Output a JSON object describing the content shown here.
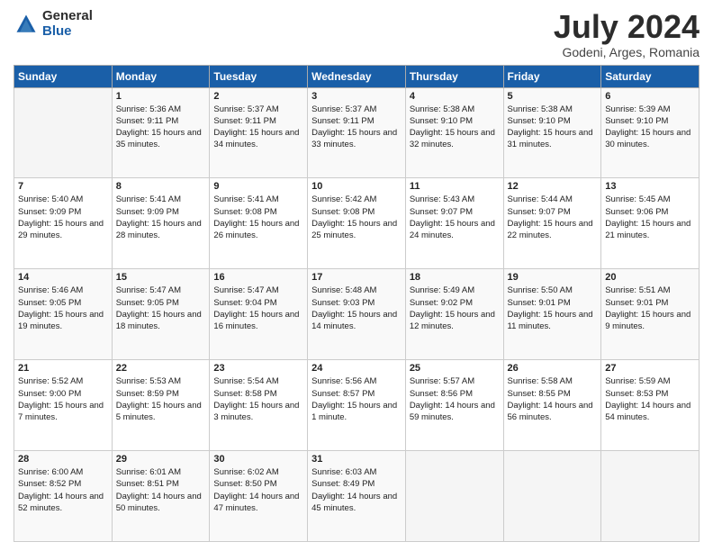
{
  "logo": {
    "general": "General",
    "blue": "Blue"
  },
  "title": {
    "month_year": "July 2024",
    "location": "Godeni, Arges, Romania"
  },
  "days_of_week": [
    "Sunday",
    "Monday",
    "Tuesday",
    "Wednesday",
    "Thursday",
    "Friday",
    "Saturday"
  ],
  "weeks": [
    [
      {
        "day": "",
        "info": ""
      },
      {
        "day": "1",
        "info": "Sunrise: 5:36 AM\nSunset: 9:11 PM\nDaylight: 15 hours and 35 minutes."
      },
      {
        "day": "2",
        "info": "Sunrise: 5:37 AM\nSunset: 9:11 PM\nDaylight: 15 hours and 34 minutes."
      },
      {
        "day": "3",
        "info": "Sunrise: 5:37 AM\nSunset: 9:11 PM\nDaylight: 15 hours and 33 minutes."
      },
      {
        "day": "4",
        "info": "Sunrise: 5:38 AM\nSunset: 9:10 PM\nDaylight: 15 hours and 32 minutes."
      },
      {
        "day": "5",
        "info": "Sunrise: 5:38 AM\nSunset: 9:10 PM\nDaylight: 15 hours and 31 minutes."
      },
      {
        "day": "6",
        "info": "Sunrise: 5:39 AM\nSunset: 9:10 PM\nDaylight: 15 hours and 30 minutes."
      }
    ],
    [
      {
        "day": "7",
        "info": "Sunrise: 5:40 AM\nSunset: 9:09 PM\nDaylight: 15 hours and 29 minutes."
      },
      {
        "day": "8",
        "info": "Sunrise: 5:41 AM\nSunset: 9:09 PM\nDaylight: 15 hours and 28 minutes."
      },
      {
        "day": "9",
        "info": "Sunrise: 5:41 AM\nSunset: 9:08 PM\nDaylight: 15 hours and 26 minutes."
      },
      {
        "day": "10",
        "info": "Sunrise: 5:42 AM\nSunset: 9:08 PM\nDaylight: 15 hours and 25 minutes."
      },
      {
        "day": "11",
        "info": "Sunrise: 5:43 AM\nSunset: 9:07 PM\nDaylight: 15 hours and 24 minutes."
      },
      {
        "day": "12",
        "info": "Sunrise: 5:44 AM\nSunset: 9:07 PM\nDaylight: 15 hours and 22 minutes."
      },
      {
        "day": "13",
        "info": "Sunrise: 5:45 AM\nSunset: 9:06 PM\nDaylight: 15 hours and 21 minutes."
      }
    ],
    [
      {
        "day": "14",
        "info": "Sunrise: 5:46 AM\nSunset: 9:05 PM\nDaylight: 15 hours and 19 minutes."
      },
      {
        "day": "15",
        "info": "Sunrise: 5:47 AM\nSunset: 9:05 PM\nDaylight: 15 hours and 18 minutes."
      },
      {
        "day": "16",
        "info": "Sunrise: 5:47 AM\nSunset: 9:04 PM\nDaylight: 15 hours and 16 minutes."
      },
      {
        "day": "17",
        "info": "Sunrise: 5:48 AM\nSunset: 9:03 PM\nDaylight: 15 hours and 14 minutes."
      },
      {
        "day": "18",
        "info": "Sunrise: 5:49 AM\nSunset: 9:02 PM\nDaylight: 15 hours and 12 minutes."
      },
      {
        "day": "19",
        "info": "Sunrise: 5:50 AM\nSunset: 9:01 PM\nDaylight: 15 hours and 11 minutes."
      },
      {
        "day": "20",
        "info": "Sunrise: 5:51 AM\nSunset: 9:01 PM\nDaylight: 15 hours and 9 minutes."
      }
    ],
    [
      {
        "day": "21",
        "info": "Sunrise: 5:52 AM\nSunset: 9:00 PM\nDaylight: 15 hours and 7 minutes."
      },
      {
        "day": "22",
        "info": "Sunrise: 5:53 AM\nSunset: 8:59 PM\nDaylight: 15 hours and 5 minutes."
      },
      {
        "day": "23",
        "info": "Sunrise: 5:54 AM\nSunset: 8:58 PM\nDaylight: 15 hours and 3 minutes."
      },
      {
        "day": "24",
        "info": "Sunrise: 5:56 AM\nSunset: 8:57 PM\nDaylight: 15 hours and 1 minute."
      },
      {
        "day": "25",
        "info": "Sunrise: 5:57 AM\nSunset: 8:56 PM\nDaylight: 14 hours and 59 minutes."
      },
      {
        "day": "26",
        "info": "Sunrise: 5:58 AM\nSunset: 8:55 PM\nDaylight: 14 hours and 56 minutes."
      },
      {
        "day": "27",
        "info": "Sunrise: 5:59 AM\nSunset: 8:53 PM\nDaylight: 14 hours and 54 minutes."
      }
    ],
    [
      {
        "day": "28",
        "info": "Sunrise: 6:00 AM\nSunset: 8:52 PM\nDaylight: 14 hours and 52 minutes."
      },
      {
        "day": "29",
        "info": "Sunrise: 6:01 AM\nSunset: 8:51 PM\nDaylight: 14 hours and 50 minutes."
      },
      {
        "day": "30",
        "info": "Sunrise: 6:02 AM\nSunset: 8:50 PM\nDaylight: 14 hours and 47 minutes."
      },
      {
        "day": "31",
        "info": "Sunrise: 6:03 AM\nSunset: 8:49 PM\nDaylight: 14 hours and 45 minutes."
      },
      {
        "day": "",
        "info": ""
      },
      {
        "day": "",
        "info": ""
      },
      {
        "day": "",
        "info": ""
      }
    ]
  ]
}
